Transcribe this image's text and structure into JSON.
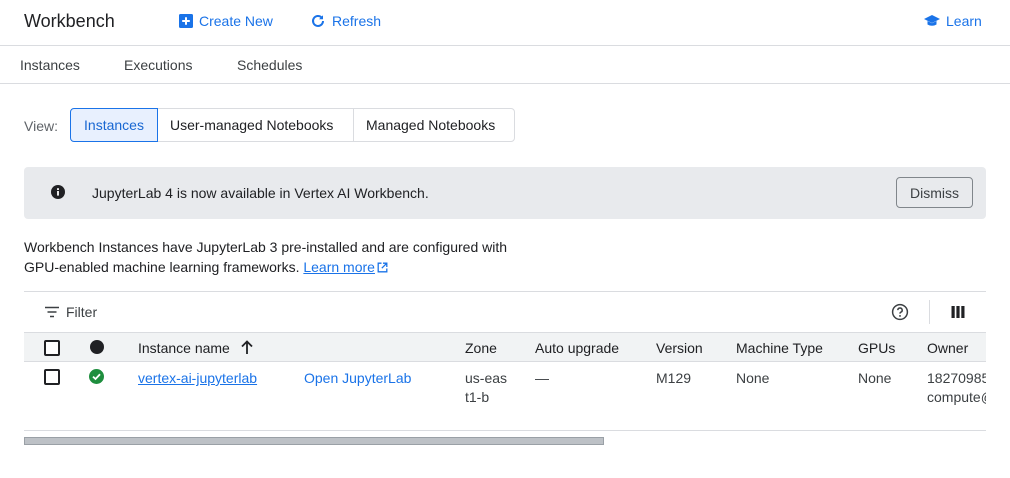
{
  "header": {
    "title": "Workbench",
    "create_new": "Create New",
    "refresh": "Refresh",
    "learn": "Learn"
  },
  "tabs": [
    "Instances",
    "Executions",
    "Schedules"
  ],
  "view": {
    "label": "View:",
    "options": [
      "Instances",
      "User-managed Notebooks",
      "Managed Notebooks"
    ],
    "selected": "Instances"
  },
  "banner": {
    "message": "JupyterLab 4 is now available in Vertex AI Workbench.",
    "dismiss": "Dismiss"
  },
  "description": {
    "line1": "Workbench Instances have JupyterLab 3 pre-installed and are configured with",
    "line2": "GPU-enabled machine learning frameworks.",
    "link": "Learn more"
  },
  "filter": {
    "label": "Filter"
  },
  "table": {
    "columns": {
      "name": "Instance name",
      "zone": "Zone",
      "auto_upgrade": "Auto upgrade",
      "version": "Version",
      "machine_type": "Machine Type",
      "gpus": "GPUs",
      "owner": "Owner"
    },
    "rows": [
      {
        "name": "vertex-ai-jupyterlab",
        "action": "Open JupyterLab",
        "zone": "us-east1-b",
        "auto_upgrade": "—",
        "version": "M129",
        "machine_type": "None",
        "gpus": "None",
        "owner_line1": "18270985",
        "owner_line2": "compute@"
      }
    ]
  },
  "colors": {
    "accent": "#1a73e8",
    "banner_bg": "#e8eaed",
    "status_ok": "#1e8e3e"
  }
}
